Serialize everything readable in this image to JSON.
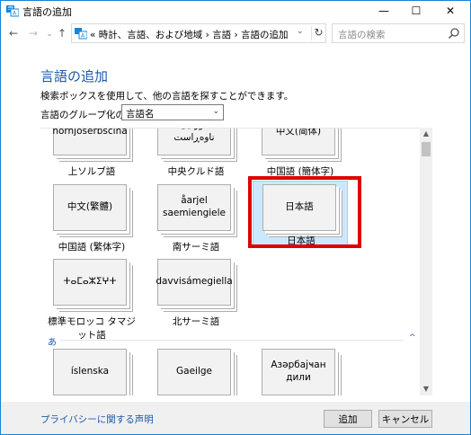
{
  "window": {
    "title": "言語の追加",
    "minimize": "—",
    "maximize": "☐",
    "close": "✕"
  },
  "nav": {
    "back": "←",
    "forward": "→",
    "recent": "⌄",
    "up": "↑",
    "breadcrumb": "« 時計、言語、および地域 › 言語 › 言語の追加",
    "dropdown": "⌄",
    "refresh": "↻",
    "search_placeholder": "言語の検索"
  },
  "content": {
    "heading": "言語の追加",
    "description": "検索ボックスを使用して、他の言語を探すことができます。",
    "group_label": "言語のグループ化の基準:",
    "group_select": "言語名",
    "group_arrow": "⌄"
  },
  "tiles": [
    {
      "native": "hornjoserbšćina",
      "caption": "上ソルブ語",
      "selected": false
    },
    {
      "native": "کوردیی ناوەڕاست",
      "caption": "中央クルド語",
      "selected": false
    },
    {
      "native": "中文(简体)",
      "caption": "中国語 (簡体字)",
      "selected": false
    },
    {
      "native": "中文(繁體)",
      "caption": "中国語 (繁体字)",
      "selected": false
    },
    {
      "native": "åarjel saemiengiele",
      "caption": "南サーミ語",
      "selected": false
    },
    {
      "native": "日本語",
      "caption": "日本語",
      "selected": true
    },
    {
      "native": "ⵜⴰⵎⴰⵣⵉⵖⵜ",
      "caption": "標準モロッコ タマジット語",
      "selected": false
    },
    {
      "native": "davvisámegiella",
      "caption": "北サーミ語",
      "selected": false
    },
    {
      "native": "íslenska",
      "caption": "",
      "selected": false
    },
    {
      "native": "Gaeilge",
      "caption": "",
      "selected": false
    },
    {
      "native": "Азәрбајҹан дили",
      "caption": "",
      "selected": false
    }
  ],
  "section": {
    "letter": "あ",
    "caret": "^"
  },
  "scrollbar": {
    "up": "▲",
    "down": "▼"
  },
  "footer": {
    "privacy": "プライバシーに関する声明",
    "add": "追加",
    "cancel": "キャンセル"
  },
  "colors": {
    "accent": "#1e5aa8",
    "highlight": "#e00000",
    "selection": "#cce8ff"
  }
}
